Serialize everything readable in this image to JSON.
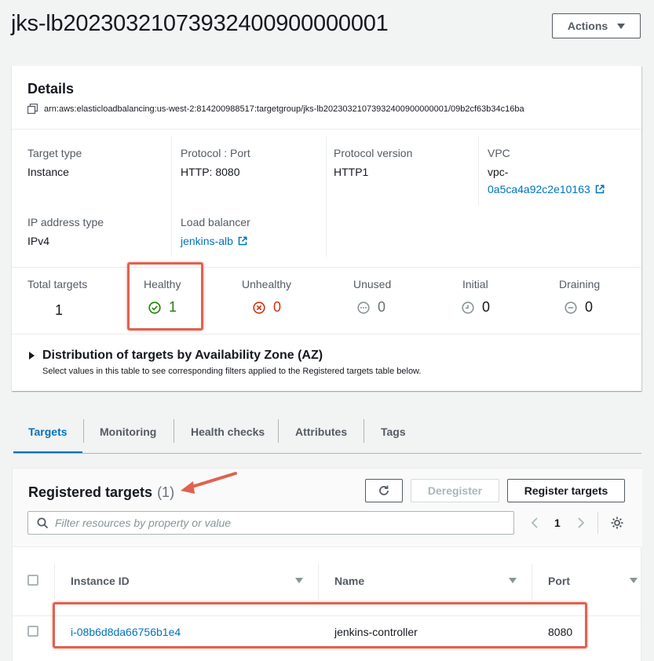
{
  "header": {
    "title": "jks-lb20230321073932400900000001",
    "actions_label": "Actions"
  },
  "details": {
    "heading": "Details",
    "arn": "arn:aws:elasticloadbalancing:us-west-2:814200988517:targetgroup/jks-lb20230321073932400900000001/09b2cf63b34c16ba",
    "fields": {
      "target_type_label": "Target type",
      "target_type_value": "Instance",
      "protocol_port_label": "Protocol : Port",
      "protocol_port_value": "HTTP: 8080",
      "protocol_version_label": "Protocol version",
      "protocol_version_value": "HTTP1",
      "vpc_label": "VPC",
      "vpc_value_line1": "vpc-",
      "vpc_value_line2": "0a5ca4a92c2e10163",
      "ip_type_label": "IP address type",
      "ip_type_value": "IPv4",
      "lb_label": "Load balancer",
      "lb_value": "jenkins-alb"
    },
    "counts": {
      "total_label": "Total targets",
      "total_value": "1",
      "healthy_label": "Healthy",
      "healthy_value": "1",
      "unhealthy_label": "Unhealthy",
      "unhealthy_value": "0",
      "unused_label": "Unused",
      "unused_value": "0",
      "initial_label": "Initial",
      "initial_value": "0",
      "draining_label": "Draining",
      "draining_value": "0"
    },
    "az": {
      "title": "Distribution of targets by Availability Zone (AZ)",
      "description": "Select values in this table to see corresponding filters applied to the Registered targets table below."
    }
  },
  "tabs": [
    "Targets",
    "Monitoring",
    "Health checks",
    "Attributes",
    "Tags"
  ],
  "registered": {
    "heading": "Registered targets",
    "count": "(1)",
    "deregister_label": "Deregister",
    "register_label": "Register targets",
    "search_placeholder": "Filter resources by property or value",
    "page": "1",
    "columns": [
      "Instance ID",
      "Name",
      "Port"
    ],
    "rows": [
      {
        "instance_id": "i-08b6d8da66756b1e4",
        "name": "jenkins-controller",
        "port": "8080"
      }
    ]
  },
  "colors": {
    "link": "#0073bb",
    "healthy": "#1d8102",
    "unhealthy": "#d13212",
    "neutral": "#879596",
    "annotation": "#e0624f"
  }
}
